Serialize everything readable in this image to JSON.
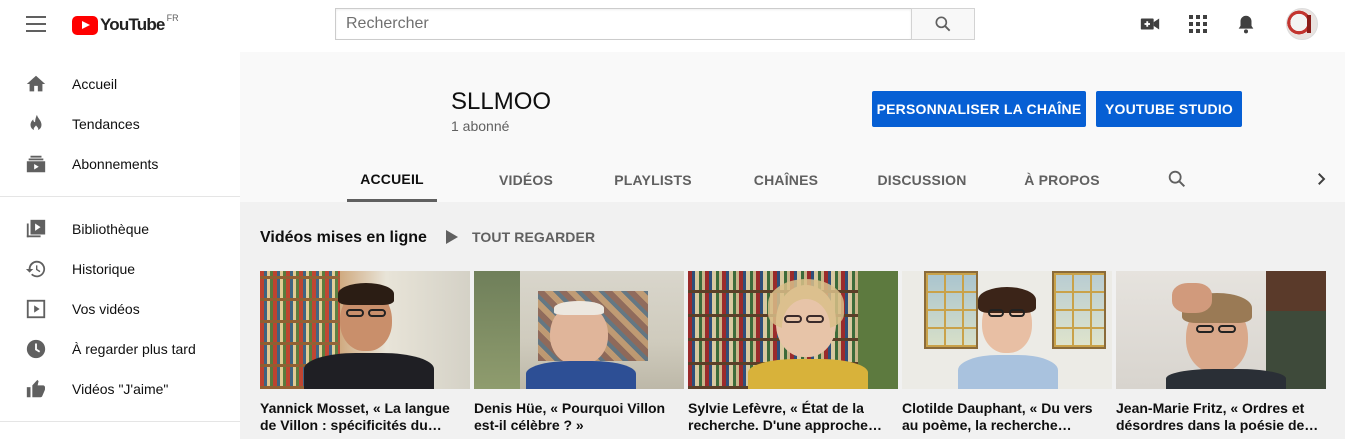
{
  "topbar": {
    "logo_text": "YouTube",
    "logo_country": "FR",
    "search_placeholder": "Rechercher",
    "icons": [
      "menu-icon",
      "create-video-icon",
      "apps-icon",
      "notifications-icon"
    ],
    "brand_color": "#ff0000"
  },
  "sidebar": {
    "items": [
      {
        "label": "Accueil",
        "icon": "home-icon"
      },
      {
        "label": "Tendances",
        "icon": "trending-icon"
      },
      {
        "label": "Abonnements",
        "icon": "subscriptions-icon"
      },
      {
        "label": "Bibliothèque",
        "icon": "library-icon"
      },
      {
        "label": "Historique",
        "icon": "history-icon"
      },
      {
        "label": "Vos vidéos",
        "icon": "your-videos-icon"
      },
      {
        "label": "À regarder plus tard",
        "icon": "watch-later-icon"
      },
      {
        "label": "Vidéos \"J'aime\"",
        "icon": "liked-videos-icon"
      }
    ]
  },
  "channel": {
    "name": "SLLMOO",
    "subscribers": "1 abonné",
    "customize_label": "PERSONNALISER LA CHAÎNE",
    "studio_label": "YOUTUBE STUDIO",
    "button_color": "#065fd4"
  },
  "tabs": [
    {
      "label": "ACCUEIL",
      "active": true
    },
    {
      "label": "VIDÉOS",
      "active": false
    },
    {
      "label": "PLAYLISTS",
      "active": false
    },
    {
      "label": "CHAÎNES",
      "active": false
    },
    {
      "label": "DISCUSSION",
      "active": false
    },
    {
      "label": "À PROPOS",
      "active": false
    }
  ],
  "section": {
    "title": "Vidéos mises en ligne",
    "play_all_label": "TOUT REGARDER"
  },
  "videos": [
    {
      "title": "Yannick Mosset, « La langue de Villon : spécificités du…"
    },
    {
      "title": "Denis Hüe, « Pourquoi Villon est-il célèbre ? »"
    },
    {
      "title": "Sylvie Lefèvre, « État de la recherche. D'une approche…"
    },
    {
      "title": "Clotilde Dauphant, « Du vers au poème, la recherche…"
    },
    {
      "title": "Jean-Marie Fritz, « Ordres et désordres dans la poésie de…"
    }
  ]
}
